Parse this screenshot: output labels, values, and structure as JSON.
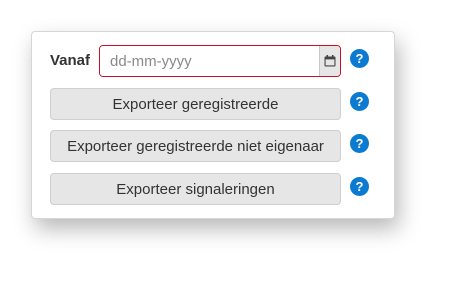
{
  "form": {
    "from_label": "Vanaf",
    "date_placeholder": "dd-mm-yyyy",
    "date_value": "",
    "calendar_icon": "calendar-icon",
    "help_icon": "question-circle-icon",
    "help_glyph": "?",
    "buttons": [
      {
        "label": "Exporteer geregistreerde"
      },
      {
        "label": "Exporteer geregistreerde niet eigenaar"
      },
      {
        "label": "Exporteer signaleringen"
      }
    ]
  },
  "colors": {
    "input_border": "#c8102e",
    "help_bg": "#0b7ad1",
    "button_bg": "#e6e6e6"
  }
}
